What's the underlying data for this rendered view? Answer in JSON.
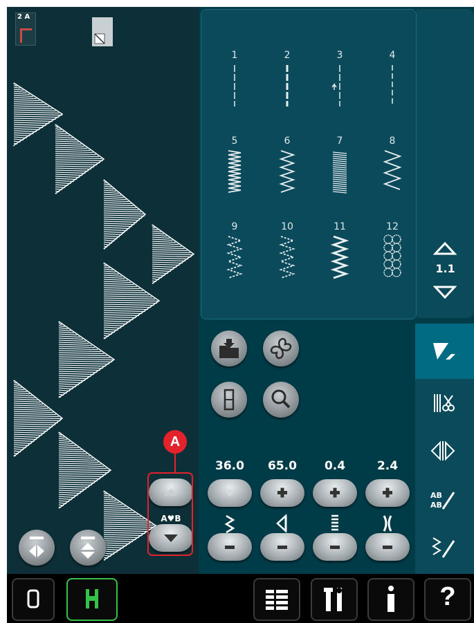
{
  "stitch_menu": {
    "stitches": [
      {
        "number": "1"
      },
      {
        "number": "2"
      },
      {
        "number": "3"
      },
      {
        "number": "4"
      },
      {
        "number": "5"
      },
      {
        "number": "6"
      },
      {
        "number": "7"
      },
      {
        "number": "8"
      },
      {
        "number": "9"
      },
      {
        "number": "10"
      },
      {
        "number": "11"
      },
      {
        "number": "12"
      }
    ],
    "page_indicator": "1.1"
  },
  "parameters": {
    "width": "36.0",
    "position": "65.0",
    "length": "0.4",
    "density": "2.4"
  },
  "pattern_controls": {
    "ab_label": "A♥B"
  },
  "callout": {
    "label": "A"
  },
  "preview": {
    "presser_foot_label": "2 A"
  },
  "bottom_bar": {
    "help_label": "?"
  },
  "colors": {
    "screen_bg": "#003b48",
    "preview_bg": "#0c2f38",
    "accent_blue": "#006b82",
    "callout_red": "#e3222b",
    "mode_green": "#36c24a"
  }
}
